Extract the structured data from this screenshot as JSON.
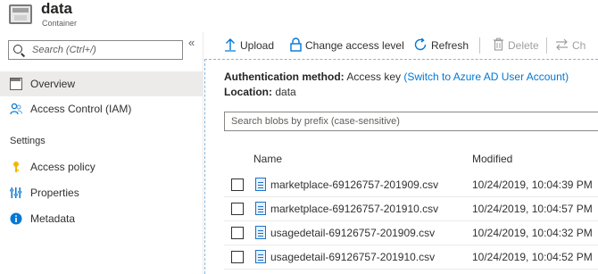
{
  "header": {
    "title": "data",
    "subtitle": "Container"
  },
  "sidebar": {
    "search_placeholder": "Search (Ctrl+/)",
    "collapse_glyph": "«",
    "items": [
      {
        "label": "Overview",
        "icon": "overview-icon",
        "active": true
      },
      {
        "label": "Access Control (IAM)",
        "icon": "people-icon",
        "active": false
      }
    ],
    "section": "Settings",
    "settings_items": [
      {
        "label": "Access policy",
        "icon": "key-icon"
      },
      {
        "label": "Properties",
        "icon": "sliders-icon"
      },
      {
        "label": "Metadata",
        "icon": "info-icon"
      }
    ]
  },
  "toolbar": {
    "upload": "Upload",
    "change_access": "Change access level",
    "refresh": "Refresh",
    "delete": "Delete",
    "change_tier": "Ch"
  },
  "main": {
    "auth_label": "Authentication method:",
    "auth_value": "Access key",
    "auth_link": "(Switch to Azure AD User Account)",
    "location_label": "Location:",
    "location_value": "data",
    "blob_search_placeholder": "Search blobs by prefix (case-sensitive)",
    "columns": {
      "name": "Name",
      "modified": "Modified"
    },
    "rows": [
      {
        "name": "marketplace-69126757-201909.csv",
        "modified": "10/24/2019, 10:04:39 PM"
      },
      {
        "name": "marketplace-69126757-201910.csv",
        "modified": "10/24/2019, 10:04:57 PM"
      },
      {
        "name": "usagedetail-69126757-201909.csv",
        "modified": "10/24/2019, 10:04:32 PM"
      },
      {
        "name": "usagedetail-69126757-201910.csv",
        "modified": "10/24/2019, 10:04:52 PM"
      }
    ]
  },
  "colors": {
    "accent": "#0078d4",
    "active_bg": "#edebe9",
    "key_yellow": "#f2b600"
  }
}
